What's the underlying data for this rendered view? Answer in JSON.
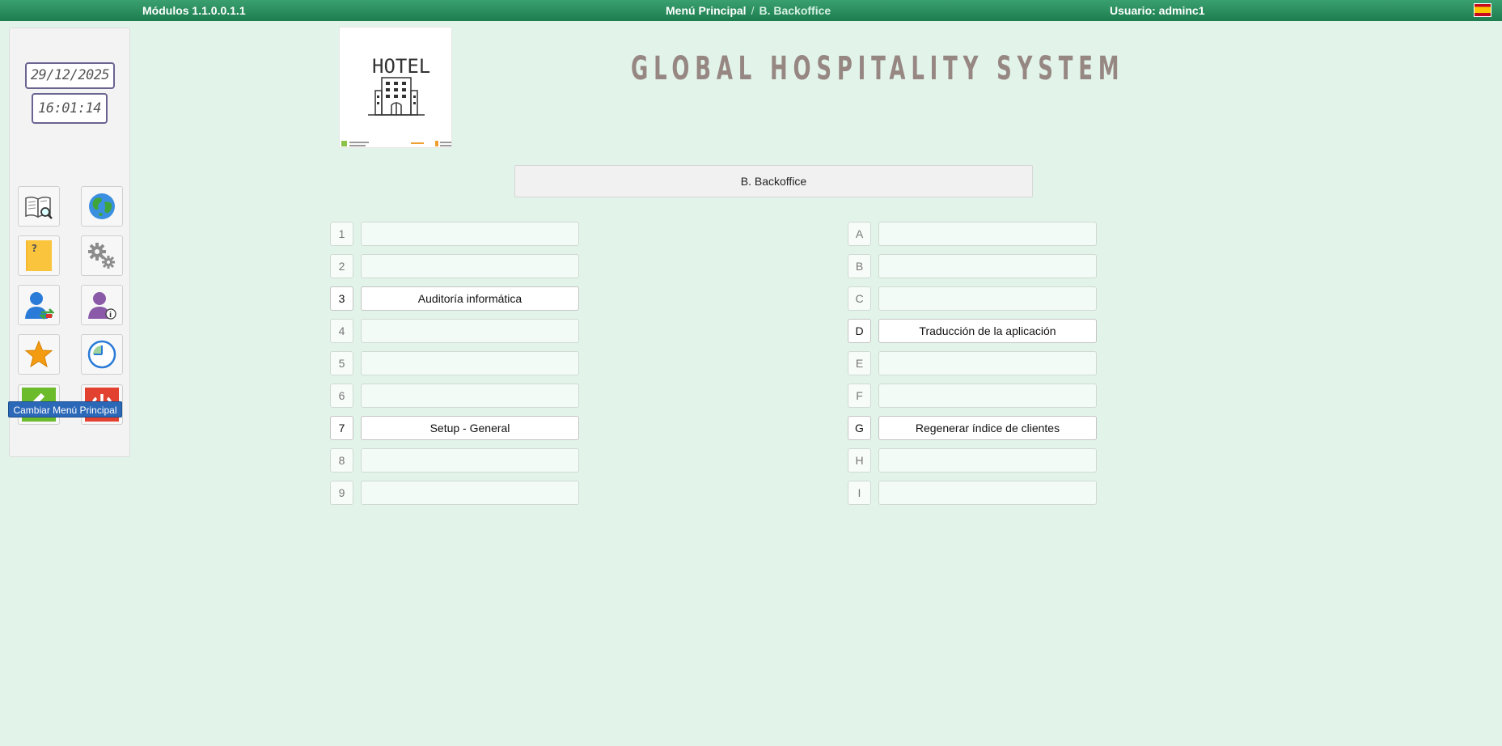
{
  "topbar": {
    "version": "Módulos 1.1.0.0.1.1",
    "crumb_root": "Menú Principal",
    "crumb_sep": "/",
    "crumb_current": "B. Backoffice",
    "user": "Usuario: adminc1",
    "language_flag": "spain-flag-icon"
  },
  "clock": {
    "date": "29/12/2025",
    "time": "16:01:14"
  },
  "sidebar": {
    "buttons": [
      {
        "icon": "manual-search-icon"
      },
      {
        "icon": "globe-icon"
      },
      {
        "icon": "help-folder-icon"
      },
      {
        "icon": "gears-icon"
      },
      {
        "icon": "user-switch-icon"
      },
      {
        "icon": "user-info-icon"
      },
      {
        "icon": "star-favorites-icon"
      },
      {
        "icon": "clock-history-icon"
      },
      {
        "icon": "back-arrow-icon"
      },
      {
        "icon": "power-off-icon"
      }
    ],
    "tooltip": "Cambiar Menú Principal"
  },
  "logo": {
    "text": "HOTEL"
  },
  "system_title": "GLOBAL HOSPITALITY SYSTEM",
  "section_title": "B. Backoffice",
  "left_menu": [
    {
      "key": "1",
      "label": ""
    },
    {
      "key": "2",
      "label": ""
    },
    {
      "key": "3",
      "label": "Auditoría informática"
    },
    {
      "key": "4",
      "label": ""
    },
    {
      "key": "5",
      "label": ""
    },
    {
      "key": "6",
      "label": ""
    },
    {
      "key": "7",
      "label": "Setup - General"
    },
    {
      "key": "8",
      "label": ""
    },
    {
      "key": "9",
      "label": ""
    }
  ],
  "right_menu": [
    {
      "key": "A",
      "label": ""
    },
    {
      "key": "B",
      "label": ""
    },
    {
      "key": "C",
      "label": ""
    },
    {
      "key": "D",
      "label": "Traducción de la aplicación"
    },
    {
      "key": "E",
      "label": ""
    },
    {
      "key": "F",
      "label": ""
    },
    {
      "key": "G",
      "label": "Regenerar índice de clientes"
    },
    {
      "key": "H",
      "label": ""
    },
    {
      "key": "I",
      "label": ""
    }
  ],
  "colors": {
    "topbar": "#1d7d4f",
    "background": "#e2f4ea",
    "tooltip": "#2b68b8",
    "title": "#978783"
  }
}
